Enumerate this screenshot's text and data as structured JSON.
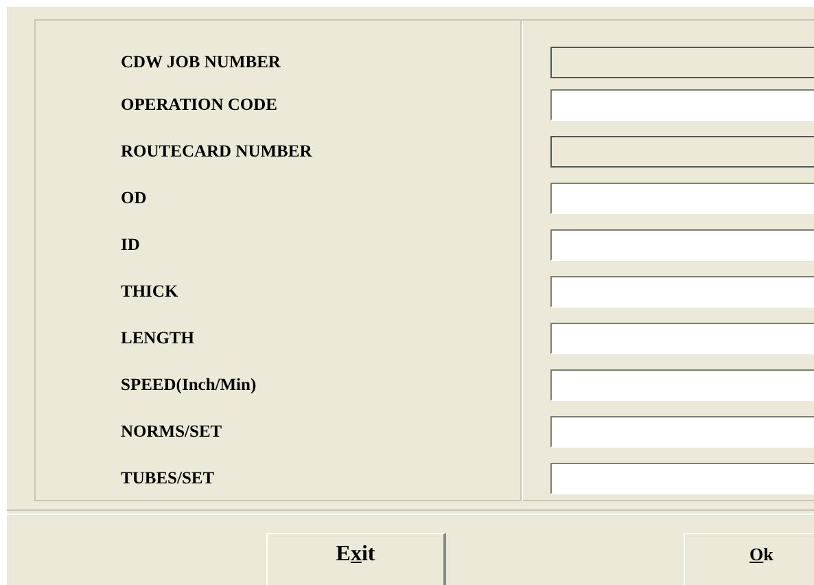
{
  "fields": [
    {
      "label": "CDW JOB NUMBER",
      "disabled": true
    },
    {
      "label": "OPERATION CODE",
      "disabled": false
    },
    {
      "label": "ROUTECARD NUMBER",
      "disabled": true
    },
    {
      "label": "OD",
      "disabled": false
    },
    {
      "label": "ID",
      "disabled": false
    },
    {
      "label": "THICK",
      "disabled": false
    },
    {
      "label": "LENGTH",
      "disabled": false
    },
    {
      "label": "SPEED(Inch/Min)",
      "disabled": false
    },
    {
      "label": "NORMS/SET",
      "disabled": false
    },
    {
      "label": "TUBES/SET",
      "disabled": false
    }
  ],
  "buttons": [
    {
      "kind": "exit",
      "pre": "E",
      "key": "x",
      "post": "it"
    },
    {
      "kind": "ok",
      "key": "O",
      "post": "k"
    }
  ]
}
